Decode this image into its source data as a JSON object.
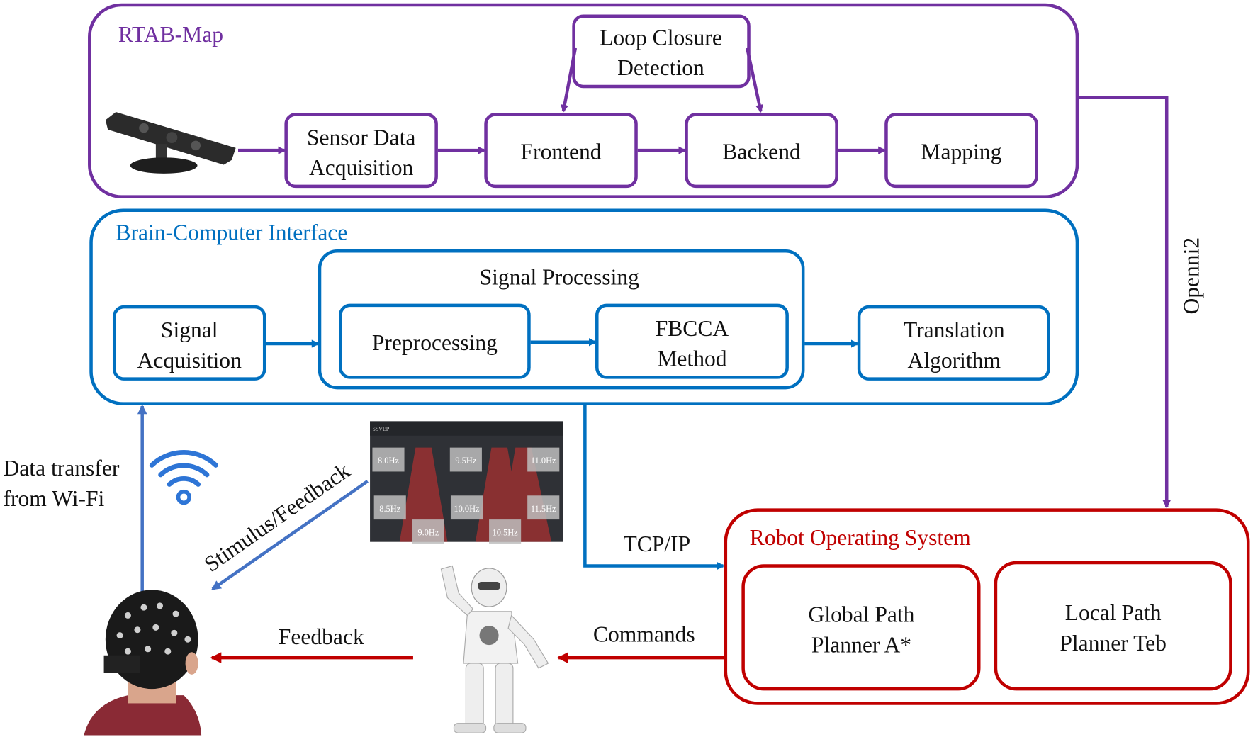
{
  "colors": {
    "rtab": "#7030a0",
    "bci": "#0070c0",
    "ros": "#c00000",
    "link": "#4472c4"
  },
  "rtab": {
    "title": "RTAB-Map",
    "loop_closure": [
      "Loop Closure",
      "Detection"
    ],
    "sensor": [
      "Sensor Data",
      "Acquisition"
    ],
    "frontend": "Frontend",
    "backend": "Backend",
    "mapping": "Mapping",
    "camera_icon": "depth-camera-photo"
  },
  "openni": "Openni2",
  "bci": {
    "title": "Brain-Computer Interface",
    "signal_acquisition": [
      "Signal",
      "Acquisition"
    ],
    "signal_processing": "Signal Processing",
    "preprocessing": "Preprocessing",
    "fbcca": [
      "FBCCA",
      "Method"
    ],
    "translation": [
      "Translation",
      "Algorithm"
    ]
  },
  "tcp": "TCP/IP",
  "wifi": {
    "label": [
      "Data transfer",
      "from Wi-Fi"
    ],
    "icon": "wifi-icon"
  },
  "stimulus": "Stimulus/Feedback",
  "ssvep": {
    "title": "SSVEP",
    "targets": [
      "8.0Hz",
      "9.5Hz",
      "11.0Hz",
      "8.5Hz",
      "10.0Hz",
      "11.5Hz",
      "9.0Hz",
      "10.5Hz"
    ]
  },
  "ros": {
    "title": "Robot Operating System",
    "global": [
      "Global Path",
      "Planner A*"
    ],
    "local": [
      "Local Path",
      "Planner Teb"
    ]
  },
  "commands": "Commands",
  "feedback": "Feedback"
}
